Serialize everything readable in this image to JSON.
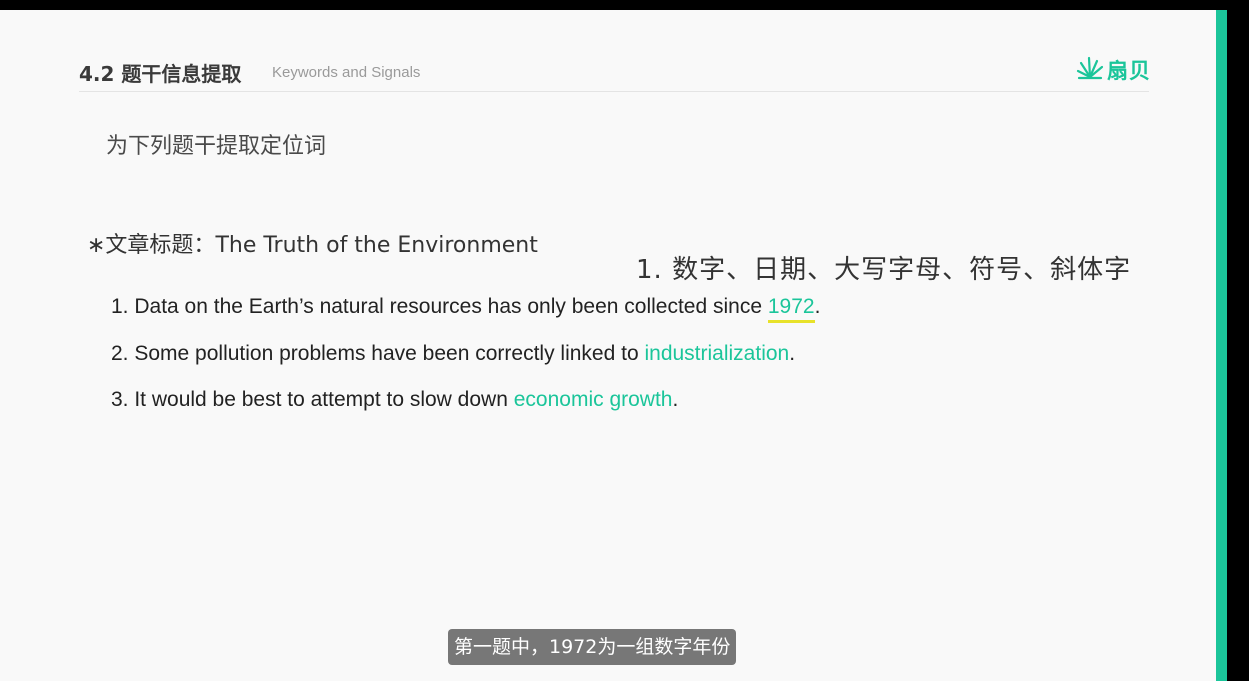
{
  "colors": {
    "accent": "#1bc59a",
    "underline": "#e8e22a"
  },
  "header": {
    "section_title": "4.2 题干信息提取",
    "section_subtitle": "Keywords and Signals",
    "logo_icon": "fan-burst-icon",
    "logo_text": "扇贝"
  },
  "slide": {
    "instruction": "为下列题干提取定位词",
    "article_title_prefix": "∗文章标题：",
    "article_title": "The Truth of the Environment",
    "overlay_note": "1. 数字、日期、大写字母、符号、斜体字",
    "questions": [
      {
        "before": "1. Data on the Earth’s natural resources has only been collected since ",
        "keyword": "1972",
        "after": "."
      },
      {
        "before": "2. Some pollution problems have been correctly linked to ",
        "keyword": "industrialization",
        "after": "."
      },
      {
        "before": "3. It would be best to attempt to slow down ",
        "keyword": "economic growth",
        "after": "."
      }
    ]
  },
  "caption": {
    "text": "第一题中，1972为一组数字年份"
  }
}
